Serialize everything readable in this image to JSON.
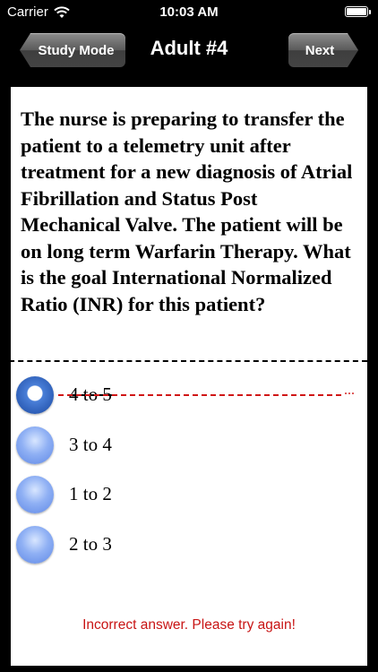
{
  "status_bar": {
    "carrier": "Carrier",
    "time": "10:03 AM"
  },
  "nav": {
    "back_label": "Study Mode",
    "title": "Adult #4",
    "next_label": "Next"
  },
  "question": {
    "text": "The nurse is preparing to transfer the patient to a telemetry unit after treatment for a new diagnosis of Atrial Fibrillation and Status Post Mechanical Valve. The patient will be on long term Warfarin Therapy. What is the goal International Normalized Ratio (INR) for this patient?"
  },
  "answers": [
    {
      "label": "4 to 5",
      "selected": true,
      "incorrect": true
    },
    {
      "label": "3 to 4",
      "selected": false
    },
    {
      "label": "1 to 2",
      "selected": false
    },
    {
      "label": "2 to 3",
      "selected": false
    }
  ],
  "feedback": {
    "text": "Incorrect answer. Please try again!",
    "marker": "..."
  },
  "colors": {
    "error": "#c81414",
    "radio": "#7aa0ee"
  }
}
